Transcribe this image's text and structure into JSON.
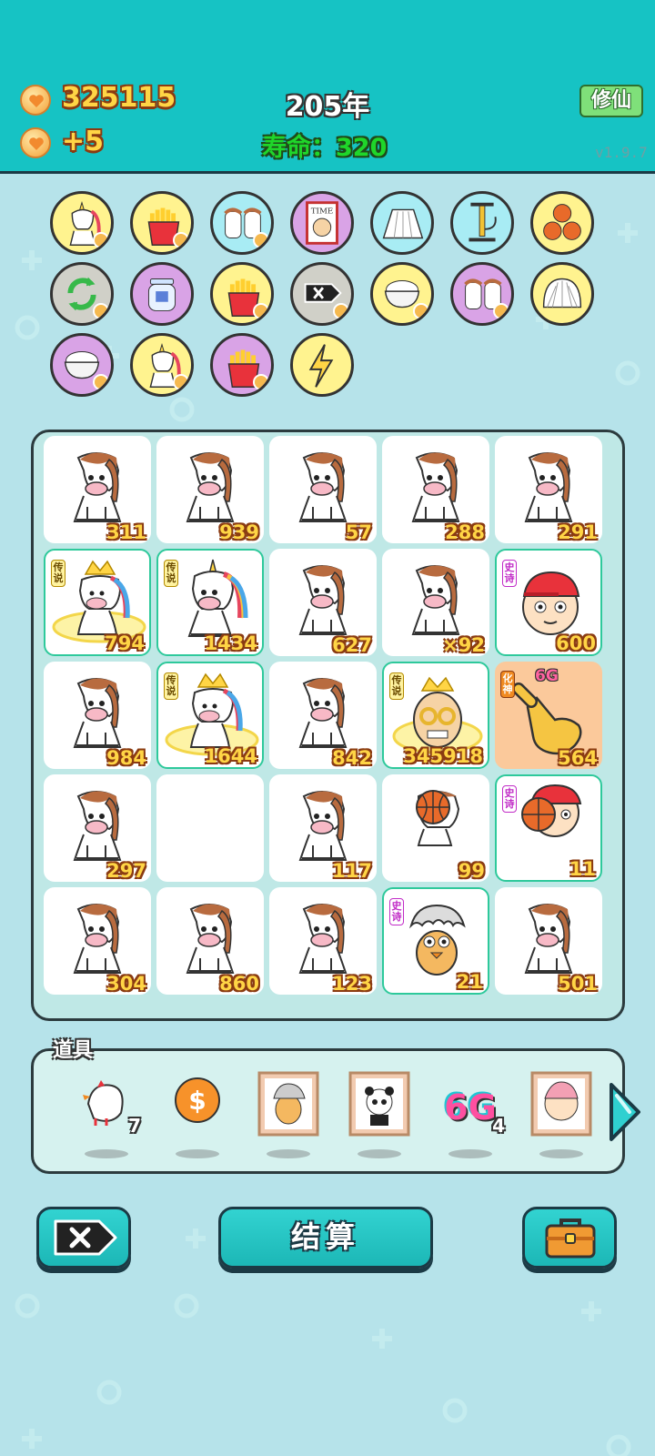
{
  "header": {
    "coins": "325115",
    "income": "+5",
    "year": "205年",
    "lifespan": "寿命：320",
    "cultivate_button": "修仙",
    "version": "v1.9.7",
    "bg_color": "#16c3c4"
  },
  "perks": [
    {
      "icon": "unicorn-icon",
      "bg": "#fff38f",
      "badge": true
    },
    {
      "icon": "fries-icon",
      "bg": "#fff38f",
      "badge": true
    },
    {
      "icon": "twin-cows-icon",
      "bg": "#a8ecf4",
      "badge": true
    },
    {
      "icon": "time-magazine-icon",
      "bg": "#d9a3e6",
      "badge": false
    },
    {
      "icon": "skirt-icon",
      "bg": "#a8ecf4",
      "badge": false
    },
    {
      "icon": "pump-icon",
      "bg": "#a8ecf4",
      "badge": false
    },
    {
      "icon": "basketballs-icon",
      "bg": "#fff38f",
      "badge": false
    },
    {
      "icon": "refresh-icon",
      "bg": "#d0d0c8",
      "badge": true
    },
    {
      "icon": "jar-icon",
      "bg": "#d9a3e6",
      "badge": false
    },
    {
      "icon": "fries-icon",
      "bg": "#fff38f",
      "badge": true
    },
    {
      "icon": "delete-tag-icon",
      "bg": "#d0d0c8",
      "badge": true
    },
    {
      "icon": "rice-bowl-icon",
      "bg": "#fff38f",
      "badge": true
    },
    {
      "icon": "twin-cows-icon",
      "bg": "#d9a3e6",
      "badge": true
    },
    {
      "icon": "shell-icon",
      "bg": "#fff38f",
      "badge": false
    },
    {
      "icon": "rice-bowl-icon",
      "bg": "#d9a3e6",
      "badge": true
    },
    {
      "icon": "unicorn-icon",
      "bg": "#fff38f",
      "badge": true
    },
    {
      "icon": "fries-icon",
      "bg": "#d9a3e6",
      "badge": true
    },
    {
      "icon": "lightning-icon",
      "bg": "#fff38f",
      "badge": false
    }
  ],
  "grid": [
    [
      {
        "icon": "cow-icon",
        "count": "311"
      },
      {
        "icon": "cow-icon",
        "count": "939"
      },
      {
        "icon": "cow-icon",
        "count": "57"
      },
      {
        "icon": "cow-icon",
        "count": "288"
      },
      {
        "icon": "cow-icon",
        "count": "291"
      }
    ],
    [
      {
        "icon": "crowned-unicorn-icon",
        "count": "794",
        "tag": "传说",
        "rarity": "legend"
      },
      {
        "icon": "unicorn-icon",
        "count": "1434",
        "tag": "传说",
        "rarity": "legend"
      },
      {
        "icon": "cow-icon",
        "count": "627"
      },
      {
        "icon": "cow-icon",
        "count": "×92"
      },
      {
        "icon": "red-cap-boy-icon",
        "count": "600",
        "tag": "史诗",
        "rarity": "epic"
      }
    ],
    [
      {
        "icon": "cow-icon",
        "count": "984"
      },
      {
        "icon": "crowned-unicorn-icon",
        "count": "1644",
        "tag": "传说",
        "rarity": "legend"
      },
      {
        "icon": "cow-icon",
        "count": "842"
      },
      {
        "icon": "crowned-old-man-icon",
        "count": "345918",
        "tag": "传说",
        "rarity": "legend"
      },
      {
        "icon": "pointing-hand-icon",
        "count": "564",
        "tag": "化神",
        "rarity": "god",
        "extra": "6G"
      }
    ],
    [
      {
        "icon": "cow-icon",
        "count": "297"
      },
      {
        "icon": "empty",
        "count": ""
      },
      {
        "icon": "cow-icon",
        "count": "117"
      },
      {
        "icon": "basketball-cow-icon",
        "count": "99"
      },
      {
        "icon": "red-cap-boy-basketball-icon",
        "count": "11",
        "tag": "史诗",
        "rarity": "epic"
      }
    ],
    [
      {
        "icon": "cow-icon",
        "count": "304"
      },
      {
        "icon": "cow-icon",
        "count": "860"
      },
      {
        "icon": "cow-icon",
        "count": "123"
      },
      {
        "icon": "gray-hair-chick-icon",
        "count": "21",
        "tag": "史诗",
        "rarity": "epic"
      },
      {
        "icon": "cow-icon",
        "count": "501"
      }
    ]
  ],
  "items": {
    "title": "道具",
    "list": [
      {
        "icon": "white-bird-icon",
        "count": "7"
      },
      {
        "icon": "dollar-coin-icon",
        "count": ""
      },
      {
        "icon": "framed-chick-icon",
        "count": ""
      },
      {
        "icon": "framed-panda-icon",
        "count": ""
      },
      {
        "icon": "6g-icon",
        "label": "6G",
        "count": "4"
      },
      {
        "icon": "framed-pink-hair-icon",
        "count": ""
      }
    ]
  },
  "buttons": {
    "settle": "结算"
  }
}
